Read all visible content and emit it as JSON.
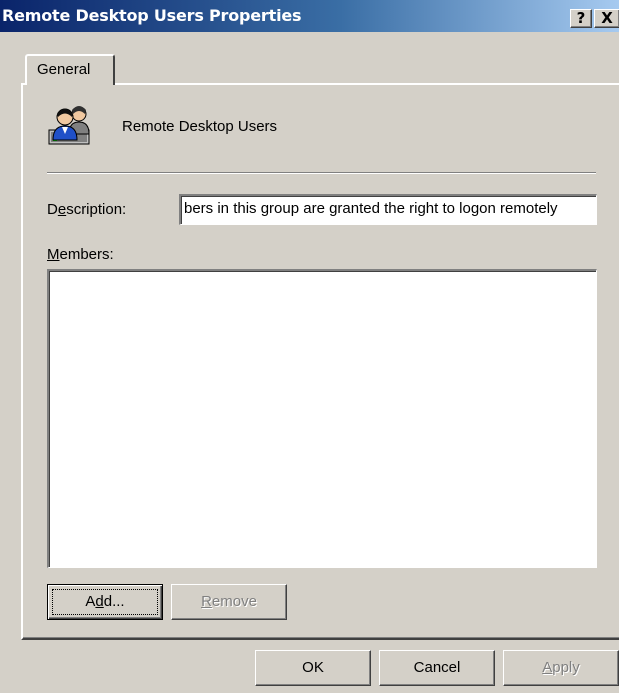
{
  "window": {
    "title": "Remote Desktop Users Properties",
    "help_label": "?",
    "close_label": "X"
  },
  "tabs": [
    {
      "label": "General",
      "selected": true
    }
  ],
  "general": {
    "group_name": "Remote Desktop Users",
    "group_icon": "user-group-icon",
    "description_label": "Description:",
    "description_value": "bers in this group are granted the right to logon remotely",
    "members_label": "Members:",
    "members": []
  },
  "buttons": {
    "add": "Add...",
    "remove": "Remove",
    "ok": "OK",
    "cancel": "Cancel",
    "apply": "Apply"
  },
  "colors": {
    "titlebar_start": "#0a246a",
    "titlebar_end": "#a6caf0",
    "face": "#d4d0c8"
  }
}
